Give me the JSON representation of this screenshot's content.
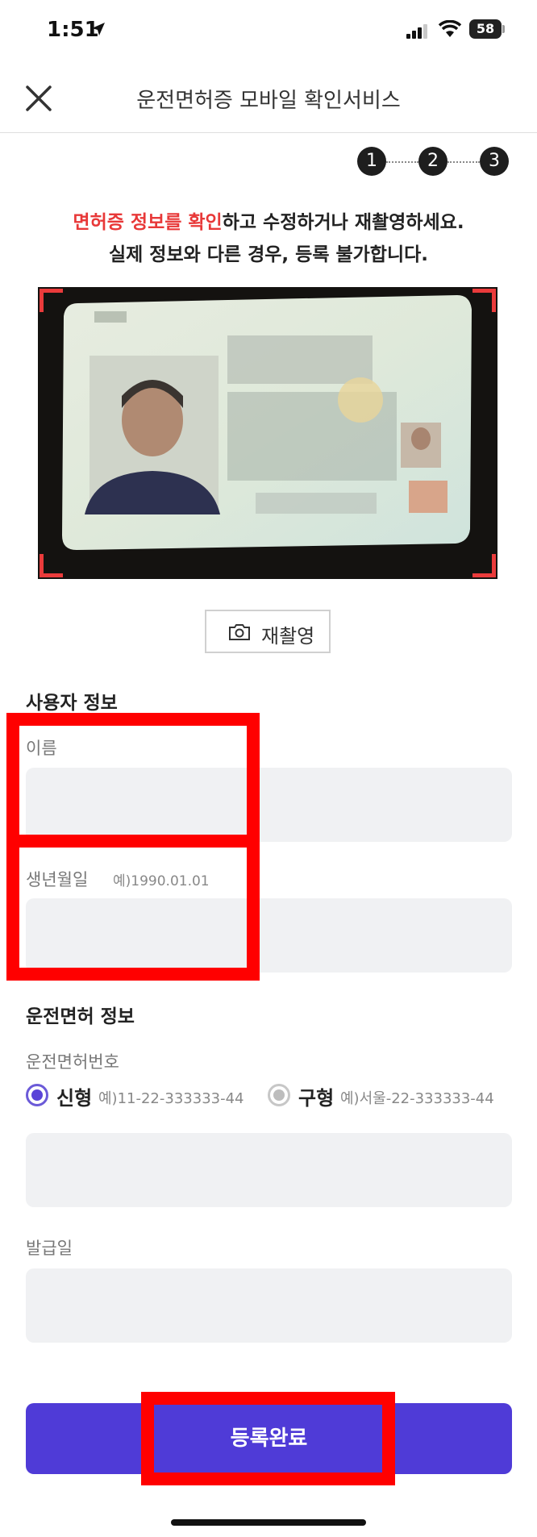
{
  "status_bar": {
    "time": "1:51",
    "battery": "58"
  },
  "header": {
    "title": "운전면허증 모바일 확인서비스",
    "close_icon": "close-icon"
  },
  "stepper": {
    "steps": [
      "1",
      "2",
      "3"
    ]
  },
  "instructions": {
    "highlight": "면허증 정보를 확인",
    "line1_rest": "하고 수정하거나 재촬영하세요.",
    "line2": "실제 정보와 다른 경우, 등록 불가합니다."
  },
  "retake": {
    "label": "재촬영",
    "icon": "camera-icon"
  },
  "user_info": {
    "section_title": "사용자 정보",
    "name_label": "이름",
    "name_value": "",
    "birth_label": "생년월일",
    "birth_hint": "예)1990.01.01",
    "birth_value": ""
  },
  "license_info": {
    "section_title": "운전면허 정보",
    "number_label": "운전면허번호",
    "new_label": "신형",
    "new_hint": "예)11-22-333333-44",
    "old_label": "구형",
    "old_hint": "예)서울-22-333333-44",
    "selected": "신형",
    "number_value": "",
    "issue_label": "발급일",
    "issue_value": ""
  },
  "submit": {
    "label": "등록완료"
  },
  "colors": {
    "accent": "#4f3bd7",
    "highlight": "#e83838",
    "annotation": "#ff0000"
  }
}
